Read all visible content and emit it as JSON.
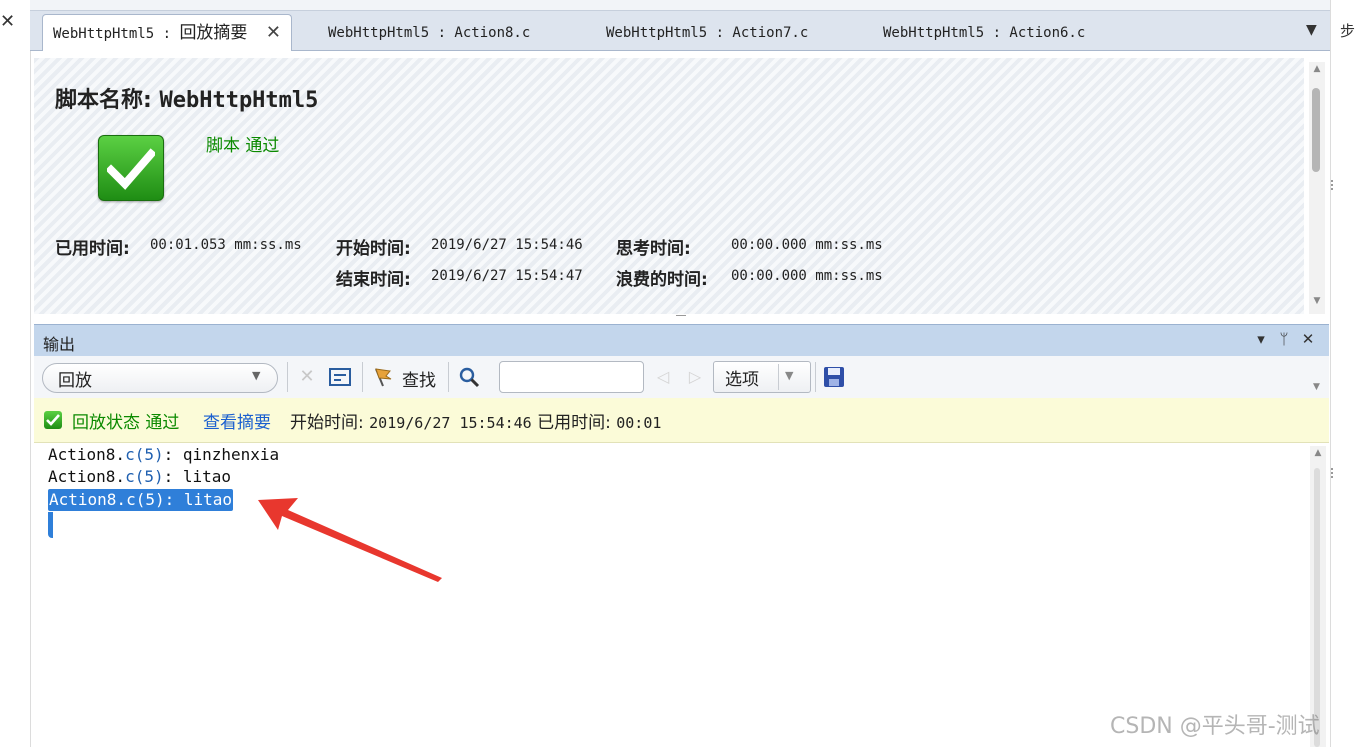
{
  "left_strip": {
    "close_glyph": "✕"
  },
  "right_strip": {
    "label": "步"
  },
  "tabs": [
    {
      "label": "WebHttpHtml5 : ",
      "label_cn": "回放摘要",
      "active": true,
      "close_glyph": "✕"
    },
    {
      "label": "WebHttpHtml5 : Action8.c",
      "active": false
    },
    {
      "label": "WebHttpHtml5 : Action7.c",
      "active": false
    },
    {
      "label": "WebHttpHtml5 : Action6.c",
      "active": false
    }
  ],
  "tab_menu_glyph": "▼",
  "summary": {
    "title_label": "脚本名称: ",
    "title_value": "WebHttpHtml5",
    "status": "脚本 通过",
    "elapsed_label": "已用时间:",
    "elapsed_value": "00:01.053 mm:ss.ms",
    "start_label": "开始时间:",
    "start_value": "2019/6/27 15:54:46",
    "end_label": "结束时间:",
    "end_value": "2019/6/27 15:54:47",
    "think_label": "思考时间:",
    "think_value": "00:00.000 mm:ss.ms",
    "wasted_label": "浪费的时间:",
    "wasted_value": "00:00.000 mm:ss.ms"
  },
  "output": {
    "title": "输出",
    "header_buttons": [
      "▾",
      "ᛘ",
      "✕"
    ],
    "mode_select": "回放",
    "find_label": "查找",
    "search_value": "",
    "options_label": "选项",
    "status_label": "回放状态 通过",
    "view_summary_link": "查看摘要",
    "status_start_label": "开始时间: ",
    "status_start_value": "2019/6/27 15:54:46",
    "status_elapsed_label": " 已用时间: ",
    "status_elapsed_value": "00:01",
    "log_lines": [
      {
        "prefix": "Action8.",
        "fn": "c(5)",
        "text": ": qinzhenxia"
      },
      {
        "prefix": "Action8.",
        "fn": "c(5)",
        "text": ": litao"
      },
      {
        "prefix": "Action8.",
        "fn": "c(5)",
        "text": ": litao"
      }
    ]
  },
  "colors": {
    "pass_green": "#0b8a00",
    "link_blue": "#1a5fcf",
    "annotation_red": "#e8372e",
    "selection_blue": "#2f7fd9"
  },
  "watermark": "CSDN @平头哥-测试"
}
